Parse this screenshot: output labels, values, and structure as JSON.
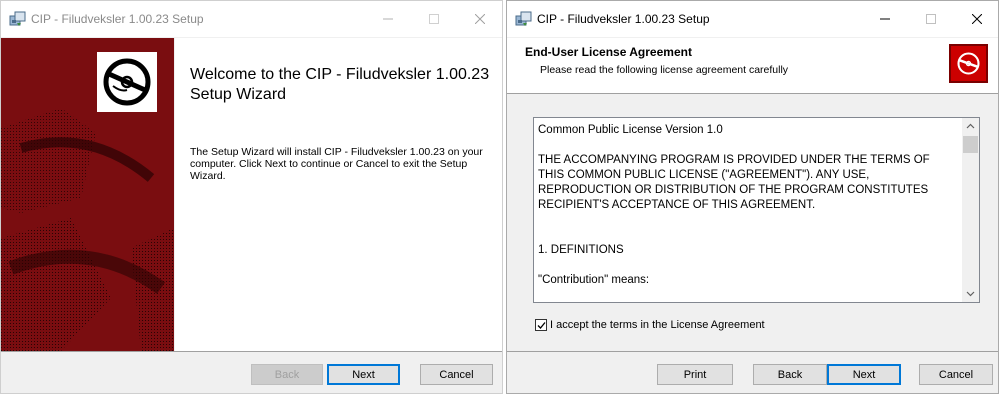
{
  "welcome_window": {
    "title": "CIP - Filudveksler 1.00.23 Setup",
    "heading": "Welcome to the CIP - Filudveksler 1.00.23 Setup Wizard",
    "body": "The Setup Wizard will install CIP - Filudveksler 1.00.23 on your computer. Click Next to continue or Cancel to exit the Setup Wizard.",
    "buttons": {
      "back": "Back",
      "next": "Next",
      "cancel": "Cancel"
    },
    "back_enabled": false
  },
  "license_window": {
    "title": "CIP - Filudveksler 1.00.23 Setup",
    "banner_title": "End-User License Agreement",
    "banner_subtitle": "Please read the following license agreement carefully",
    "license_text": "Common Public License Version 1.0\n\nTHE ACCOMPANYING PROGRAM IS PROVIDED UNDER THE TERMS OF THIS COMMON PUBLIC LICENSE (\"AGREEMENT\"). ANY USE, REPRODUCTION OR DISTRIBUTION OF THE PROGRAM CONSTITUTES RECIPIENT'S ACCEPTANCE OF THIS AGREEMENT.\n\n\n1. DEFINITIONS\n\n\"Contribution\" means:",
    "accept_label": "I accept the terms in the License Agreement",
    "accept_checked": true,
    "buttons": {
      "print": "Print",
      "back": "Back",
      "next": "Next",
      "cancel": "Cancel"
    }
  },
  "colors": {
    "brand_dark_red": "#7a0d10",
    "brand_red": "#cc0000",
    "focus_blue": "#0078d7",
    "dialog_gray": "#f0f0f0"
  },
  "icons": [
    "installer-app-icon",
    "minimize-icon",
    "maximize-icon",
    "close-icon",
    "disc-logo-icon",
    "scroll-up-icon",
    "scroll-down-icon",
    "checkmark-icon"
  ]
}
